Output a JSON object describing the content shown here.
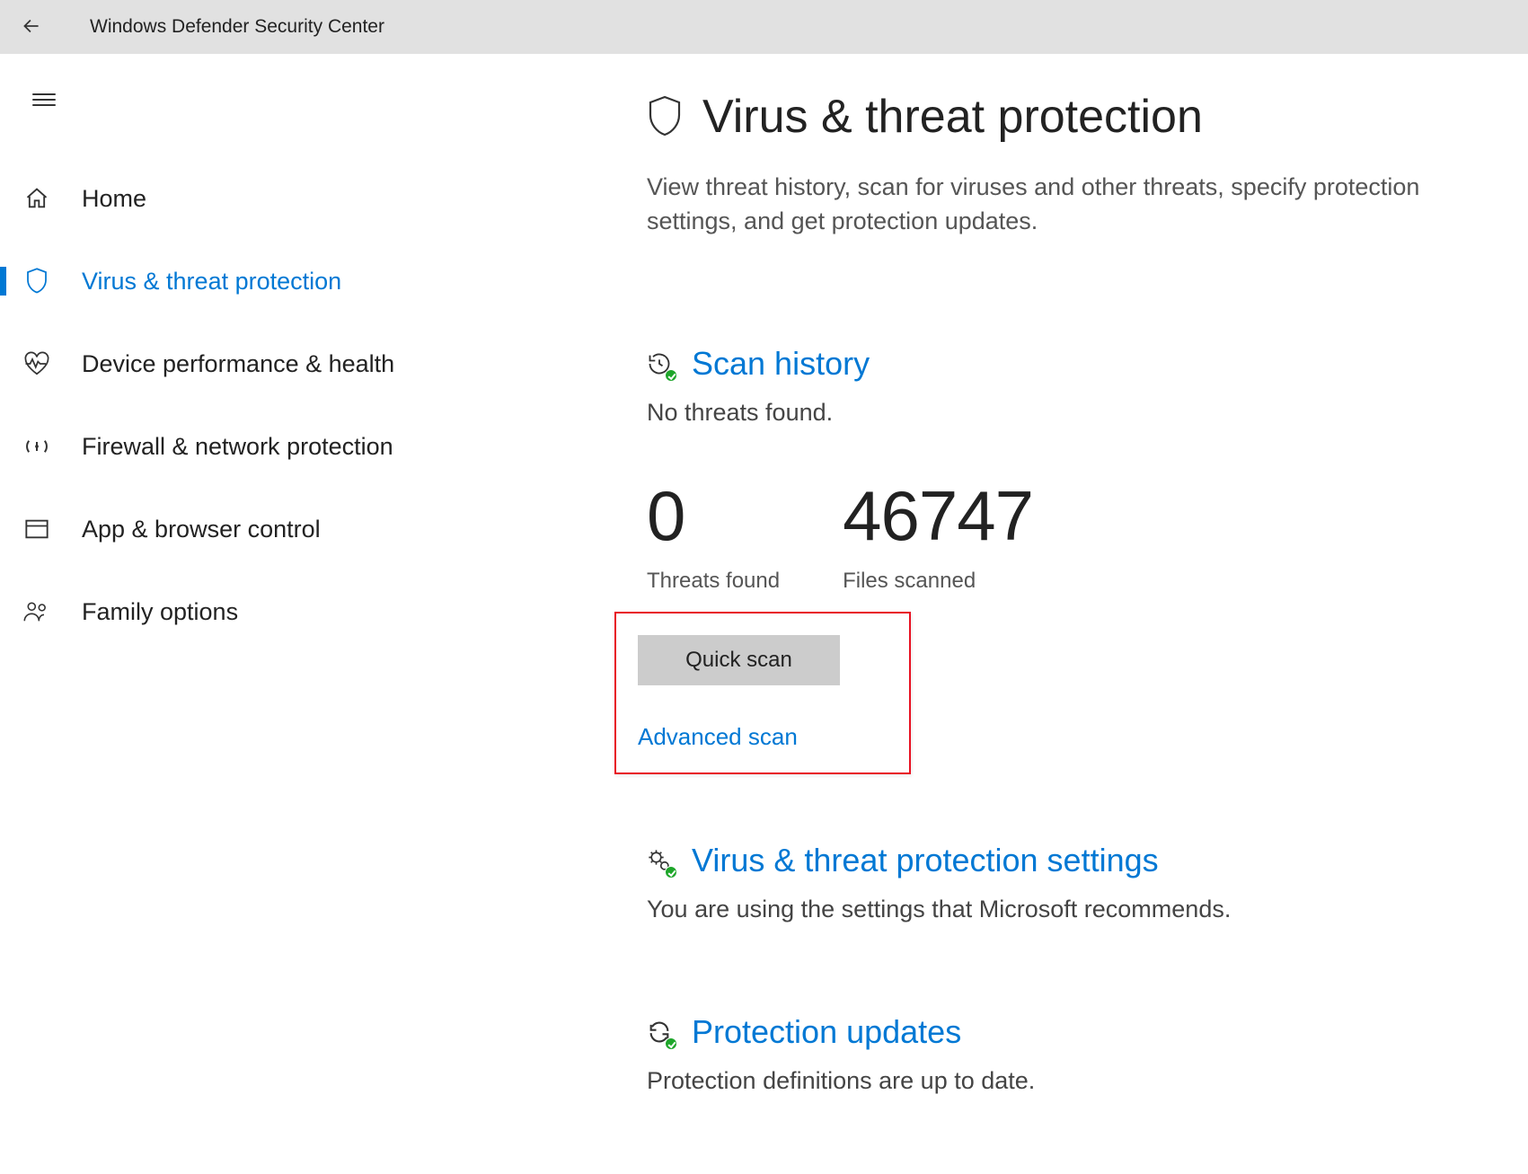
{
  "header": {
    "title": "Windows Defender Security Center"
  },
  "sidebar": {
    "items": [
      {
        "label": "Home",
        "icon": "home-icon",
        "active": false
      },
      {
        "label": "Virus & threat protection",
        "icon": "shield-icon",
        "active": true
      },
      {
        "label": "Device performance & health",
        "icon": "heart-icon",
        "active": false
      },
      {
        "label": "Firewall & network protection",
        "icon": "broadcast-icon",
        "active": false
      },
      {
        "label": "App & browser control",
        "icon": "window-icon",
        "active": false
      },
      {
        "label": "Family options",
        "icon": "people-icon",
        "active": false
      }
    ]
  },
  "page": {
    "title": "Virus & threat protection",
    "subtitle": "View threat history, scan for viruses and other threats, specify protection settings, and get protection updates."
  },
  "scan_history": {
    "title": "Scan history",
    "status": "No threats found.",
    "threats_found_value": "0",
    "threats_found_label": "Threats found",
    "files_scanned_value": "46747",
    "files_scanned_label": "Files scanned",
    "quick_scan_label": "Quick scan",
    "advanced_scan_label": "Advanced scan"
  },
  "settings": {
    "title": "Virus & threat protection settings",
    "status": "You are using the settings that Microsoft recommends."
  },
  "updates": {
    "title": "Protection updates",
    "status": "Protection definitions are up to date."
  },
  "colors": {
    "accent": "#0078d4",
    "danger": "#e81123",
    "success": "#1ea62a"
  }
}
